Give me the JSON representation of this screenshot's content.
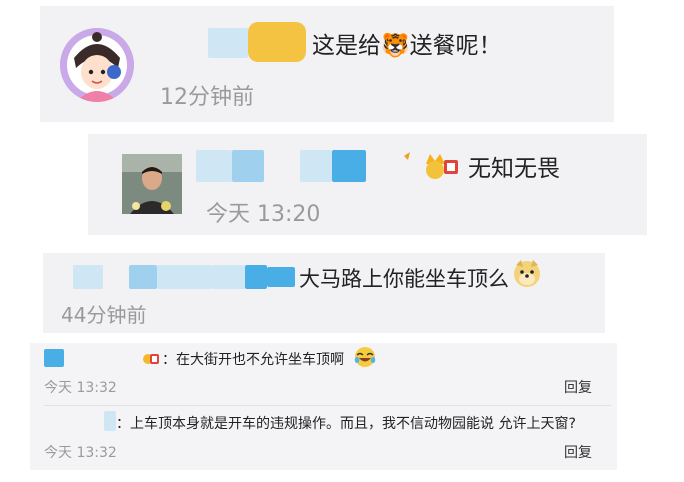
{
  "comments": [
    {
      "text": "这是给🐯送餐呢！",
      "time": "12分钟前"
    },
    {
      "text": "无知无畏",
      "time": "今天 13:20"
    },
    {
      "text": "大马路上你能坐车顶么",
      "time": "44分钟前"
    }
  ],
  "replies": [
    {
      "text": "：在大街开也不允许坐车顶啊",
      "time": "今天 13:32",
      "action": "回复"
    },
    {
      "text": "：上车顶本身就是开车的违规操作。而且，我不信动物园能说 允许上天窗?",
      "time": "今天 13:32",
      "action": "回复"
    }
  ],
  "icons": [
    "avatar-cartoon",
    "avatar-man",
    "tiger-emoji",
    "crown-badge-icon",
    "doge-emoji",
    "badge-icon",
    "laugh-cry-emoji"
  ],
  "colors": {
    "card_bg": "#f2f2f4",
    "time": "#9a9a9a",
    "blur_blue": "#4aaee6"
  }
}
